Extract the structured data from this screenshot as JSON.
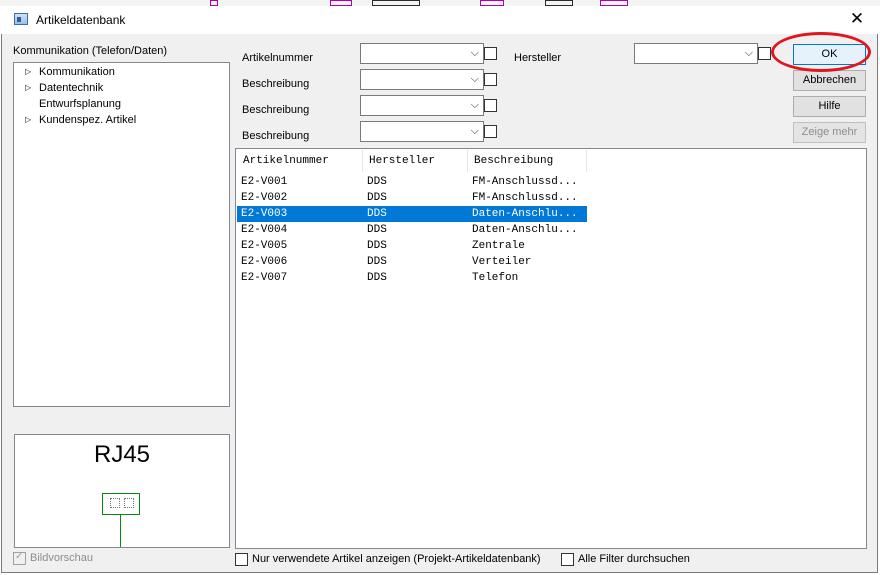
{
  "window": {
    "title": "Artikeldatenbank",
    "close_glyph": "✕"
  },
  "category_label": "Kommunikation (Telefon/Daten)",
  "tree": [
    {
      "label": "Kommunikation",
      "expandable": true
    },
    {
      "label": "Datentechnik",
      "expandable": true
    },
    {
      "label": "Entwurfsplanung",
      "expandable": false
    },
    {
      "label": "Kundenspez. Artikel",
      "expandable": true
    }
  ],
  "filters": {
    "artikelnummer_label": "Artikelnummer",
    "beschreibung1_label": "Beschreibung",
    "beschreibung2_label": "Beschreibung",
    "beschreibung3_label": "Beschreibung",
    "hersteller_label": "Hersteller"
  },
  "buttons": {
    "ok": "OK",
    "abbrechen": "Abbrechen",
    "hilfe": "Hilfe",
    "zeige_mehr": "Zeige mehr"
  },
  "table": {
    "columns": [
      "Artikelnummer",
      "Hersteller",
      "Beschreibung"
    ],
    "rows": [
      {
        "artikelnummer": "E2-V001",
        "hersteller": "DDS",
        "beschreibung": "FM-Anschlussd...",
        "selected": false
      },
      {
        "artikelnummer": "E2-V002",
        "hersteller": "DDS",
        "beschreibung": "FM-Anschlussd...",
        "selected": false
      },
      {
        "artikelnummer": "E2-V003",
        "hersteller": "DDS",
        "beschreibung": "Daten-Anschlu...",
        "selected": true
      },
      {
        "artikelnummer": "E2-V004",
        "hersteller": "DDS",
        "beschreibung": "Daten-Anschlu...",
        "selected": false
      },
      {
        "artikelnummer": "E2-V005",
        "hersteller": "DDS",
        "beschreibung": "Zentrale",
        "selected": false
      },
      {
        "artikelnummer": "E2-V006",
        "hersteller": "DDS",
        "beschreibung": "Verteiler",
        "selected": false
      },
      {
        "artikelnummer": "E2-V007",
        "hersteller": "DDS",
        "beschreibung": "Telefon",
        "selected": false
      }
    ]
  },
  "preview": {
    "title": "RJ45"
  },
  "footer": {
    "bildvorschau": "Bildvorschau",
    "nur_verwendete": "Nur verwendete Artikel anzeigen (Projekt-Artikeldatenbank)",
    "alle_filter": "Alle Filter durchsuchen"
  },
  "icons": {
    "tree_expand": "▷",
    "combo_arrow": "⌵",
    "checkmark": "✓"
  },
  "colors": {
    "selection": "#0078d7",
    "highlight_ring": "#e0161e",
    "symbol_green": "#0a8a0a"
  }
}
